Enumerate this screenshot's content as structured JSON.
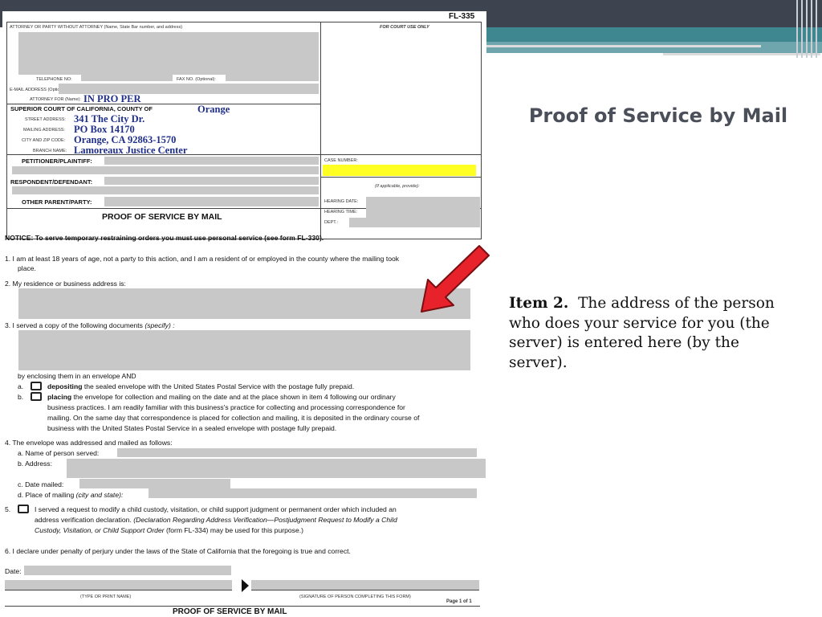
{
  "slide": {
    "title": "Proof of Service by Mail",
    "caption_item": "Item 2.",
    "caption_text": "The address of the person who does your service for you (the server) is entered here (by the server)."
  },
  "colors": {
    "top_bar": "#3d4450",
    "teal": "#3f8790",
    "highlight": "#ffff22",
    "arrow": "#e8222a",
    "filled_value": "#1f2f8a"
  },
  "form": {
    "number": "FL-335",
    "labels": {
      "attorney": "ATTORNEY OR PARTY WITHOUT ATTORNEY (Name, State Bar number, and address)",
      "court_use": "FOR COURT USE ONLY",
      "telephone": "TELEPHONE NO:",
      "fax": "FAX NO. (Optional):",
      "email": "E-MAIL ADDRESS (Optional):",
      "attorney_for": "ATTORNEY FOR (Name):",
      "court": "SUPERIOR COURT OF CALIFORNIA, COUNTY OF",
      "street": "STREET ADDRESS:",
      "mailing": "MAILING ADDRESS:",
      "city_zip": "CITY AND ZIP CODE:",
      "branch": "BRANCH NAME:",
      "petitioner": "PETITIONER/PLAINTIFF:",
      "respondent": "RESPONDENT/DEFENDANT:",
      "other_parent": "OTHER PARENT/PARTY:",
      "case_number": "CASE NUMBER:",
      "if_applicable": "(If applicable, provide):",
      "hearing_date": "HEARING DATE:",
      "hearing_time": "HEARING TIME:",
      "dept": "DEPT.:",
      "form_title": "PROOF OF SERVICE BY MAIL"
    },
    "values": {
      "attorney_for": "IN PRO PER",
      "county": "Orange",
      "street": "341 The City Dr.",
      "mailing": "PO Box 14170",
      "city_zip": "Orange, CA  92863-1570",
      "branch": "Lamoreaux Justice Center"
    },
    "notice": "NOTICE: To serve temporary restraining orders you must use personal service (see form FL-330).",
    "item1_a": "1.   I am at least 18 years of age, not a party to this action, and I am a resident of or employed in the county where the mailing took",
    "item1_b": "place.",
    "item2": "2.   My residence or business address is:",
    "item3": "3.   I served a copy of the following documents",
    "item3_specify": " (specify) :",
    "enclosing": "by enclosing them in an envelope AND",
    "a_marker": "a.",
    "a_bold": "depositing",
    "a_text": " the sealed envelope with the United States Postal Service with the postage fully prepaid.",
    "b_marker": "b.",
    "b_bold": "placing",
    "b_text1": " the envelope for collection and mailing on the date and at the place shown in item 4 following our ordinary",
    "b_text2": "business practices. I am readily familiar with this business's practice for collecting and processing correspondence for",
    "b_text3": "mailing. On the same day that correspondence is placed for collection and mailing, it is deposited in the ordinary course of",
    "b_text4": "business with the United States Postal Service in a sealed envelope with postage fully prepaid.",
    "item4": "4.   The envelope was addressed and mailed as follows:",
    "item4a": "a.   Name of person served:",
    "item4b": "b.   Address:",
    "item4c": "c.   Date mailed:",
    "item4d_label": "d.   Place of mailing",
    "item4d_specify": " (city and state):",
    "item5_marker": "5.",
    "item5_a": "I served a request to modify a child custody, visitation, or child support judgment or permanent order which included an",
    "item5_b": "address verification declaration.",
    "item5_b_italic": " (Declaration Regarding Address Verification—Postjudgment Request to Modify a Child",
    "item5_c_italic": "Custody, Visitation, or Child Support Order",
    "item5_c": " (form FL-334) may be used for this purpose.)",
    "item6": "6.   I declare under penalty of perjury under the laws of the State of California that the foregoing is true and correct.",
    "date": "Date:",
    "type_name": "(TYPE OR PRINT NAME)",
    "signature": "(SIGNATURE OF PERSON COMPLETING THIS FORM)",
    "page": "Page 1 of 1",
    "footer_title": "PROOF OF SERVICE BY MAIL"
  }
}
